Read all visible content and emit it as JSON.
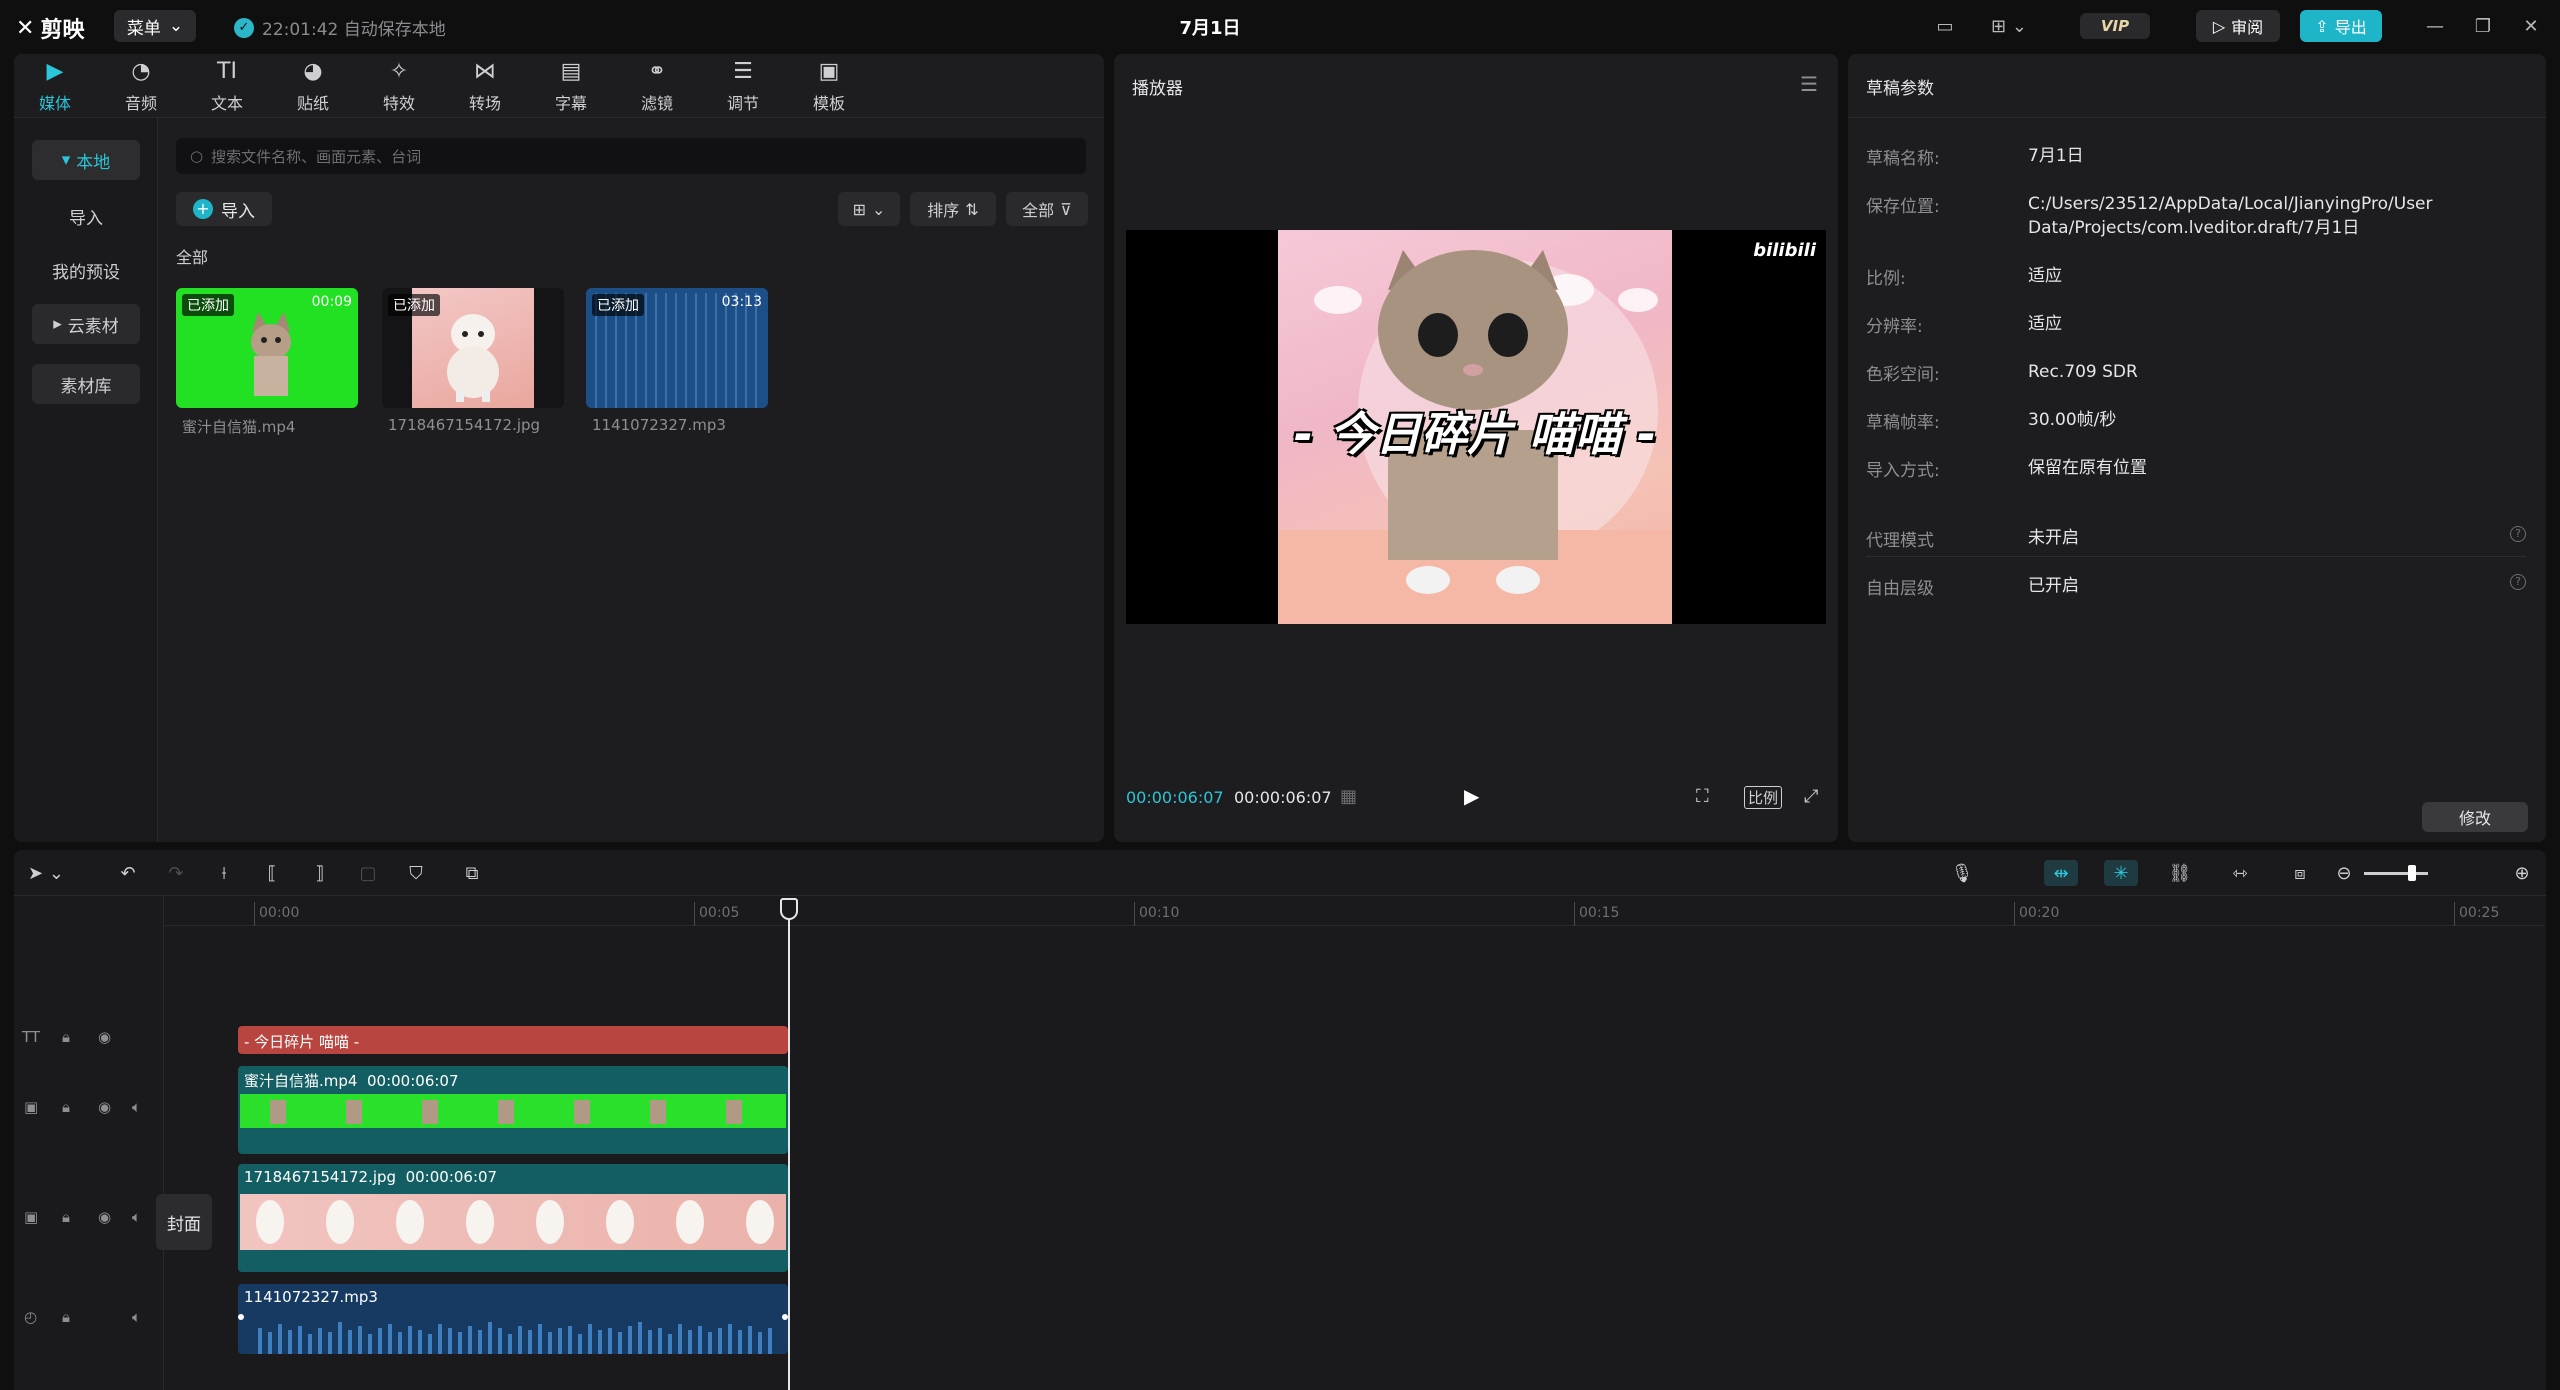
{
  "app": {
    "name": "剪映",
    "menu_label": "菜单",
    "autosave_text": "22:01:42 自动保存本地",
    "project_title": "7月1日",
    "vip_label": "VIP",
    "review_label": "审阅",
    "export_label": "导出"
  },
  "toolbar": [
    {
      "label": "媒体",
      "icon": "media-icon",
      "active": true
    },
    {
      "label": "音频",
      "icon": "audio-icon"
    },
    {
      "label": "文本",
      "icon": "text-icon"
    },
    {
      "label": "贴纸",
      "icon": "sticker-icon"
    },
    {
      "label": "特效",
      "icon": "effects-icon"
    },
    {
      "label": "转场",
      "icon": "transition-icon"
    },
    {
      "label": "字幕",
      "icon": "subtitle-icon"
    },
    {
      "label": "滤镜",
      "icon": "filter-icon"
    },
    {
      "label": "调节",
      "icon": "adjust-icon"
    },
    {
      "label": "模板",
      "icon": "template-icon"
    }
  ],
  "sidebar": {
    "local": "本地",
    "import": "导入",
    "presets": "我的预设",
    "cloud": "云素材",
    "library": "素材库"
  },
  "media": {
    "search_placeholder": "搜索文件名称、画面元素、台词",
    "import_label": "导入",
    "sort_label": "排序",
    "filter_label": "全部",
    "section_label": "全部",
    "items": [
      {
        "name": "蜜汁自信猫.mp4",
        "badge": "已添加",
        "duration": "00:09"
      },
      {
        "name": "1718467154172.jpg",
        "badge": "已添加",
        "duration": ""
      },
      {
        "name": "1141072327.mp3",
        "badge": "已添加",
        "duration": "03:13"
      }
    ]
  },
  "player": {
    "title": "播放器",
    "current_time": "00:00:06:07",
    "total_time": "00:00:06:07",
    "ratio_label": "比例",
    "caption": "- 今日碎片 喵喵 -",
    "watermark": "bilibili"
  },
  "params": {
    "title": "草稿参数",
    "rows": [
      {
        "key": "草稿名称:",
        "value": "7月1日"
      },
      {
        "key": "保存位置:",
        "value": "C:/Users/23512/AppData/Local/JianyingPro/User Data/Projects/com.lveditor.draft/7月1日"
      },
      {
        "key": "比例:",
        "value": "适应"
      },
      {
        "key": "分辨率:",
        "value": "适应"
      },
      {
        "key": "色彩空间:",
        "value": "Rec.709 SDR"
      },
      {
        "key": "草稿帧率:",
        "value": "30.00帧/秒"
      },
      {
        "key": "导入方式:",
        "value": "保留在原有位置"
      }
    ],
    "proxy_key": "代理模式",
    "proxy_value": "未开启",
    "layer_key": "自由层级",
    "layer_value": "已开启",
    "modify_label": "修改"
  },
  "timeline": {
    "ticks": [
      "00:00",
      "00:05",
      "00:10",
      "00:15",
      "00:20",
      "00:25"
    ],
    "cover_label": "封面",
    "text_clip": "- 今日碎片 喵喵 -",
    "video_clip": {
      "name": "蜜汁自信猫.mp4",
      "duration": "00:00:06:07"
    },
    "image_clip": {
      "name": "1718467154172.jpg",
      "duration": "00:00:06:07"
    },
    "audio_clip": {
      "name": "1141072327.mp3"
    }
  }
}
